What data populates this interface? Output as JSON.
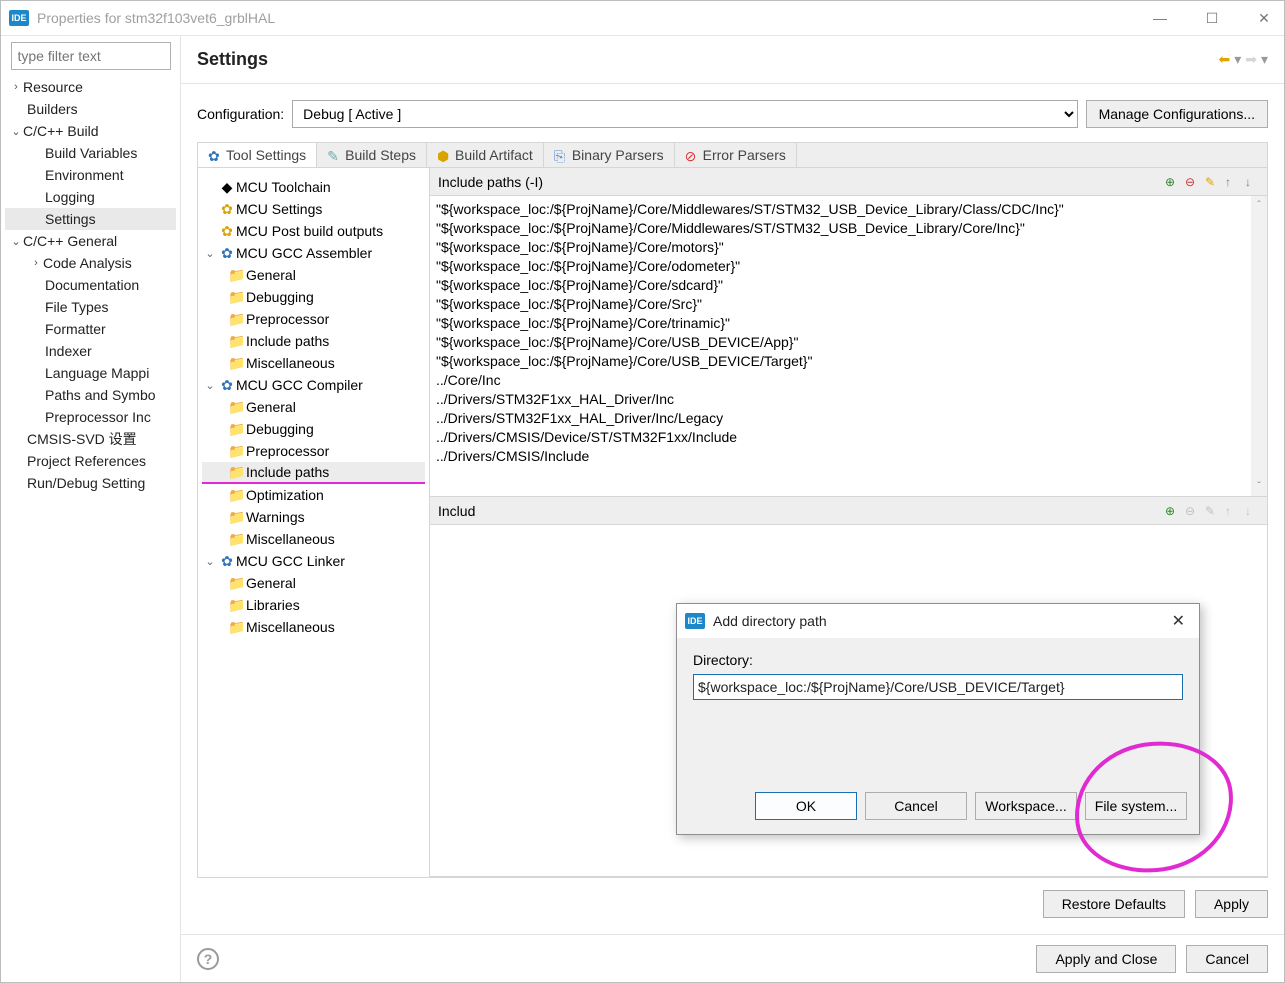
{
  "window": {
    "title": "Properties for stm32f103vet6_grblHAL",
    "ide_badge": "IDE"
  },
  "filter_placeholder": "type filter text",
  "nav": {
    "resource": "Resource",
    "builders": "Builders",
    "build": "C/C++ Build",
    "build_children": {
      "build_vars": "Build Variables",
      "env": "Environment",
      "logging": "Logging",
      "settings": "Settings"
    },
    "general": "C/C++ General",
    "general_children": {
      "code_analysis": "Code Analysis",
      "documentation": "Documentation",
      "file_types": "File Types",
      "formatter": "Formatter",
      "indexer": "Indexer",
      "lang_map": "Language Mappi",
      "paths_sym": "Paths and Symbo",
      "pre_inc": "Preprocessor Inc"
    },
    "cmsis": "CMSIS-SVD 设置",
    "proj_refs": "Project References",
    "run_debug": "Run/Debug Setting"
  },
  "header": {
    "title": "Settings"
  },
  "config": {
    "label": "Configuration:",
    "value": "Debug  [ Active ]",
    "manage": "Manage Configurations..."
  },
  "tabs": {
    "tool": "Tool Settings",
    "steps": "Build Steps",
    "artifact": "Build Artifact",
    "binary": "Binary Parsers",
    "error": "Error Parsers"
  },
  "tooltree": {
    "toolchain": "MCU Toolchain",
    "settings": "MCU Settings",
    "post": "MCU Post build outputs",
    "asm": "MCU GCC Assembler",
    "compiler": "MCU GCC Compiler",
    "linker": "MCU GCC Linker",
    "leaf": {
      "general": "General",
      "debugging": "Debugging",
      "preprocessor": "Preprocessor",
      "include": "Include paths",
      "misc": "Miscellaneous",
      "optimization": "Optimization",
      "warnings": "Warnings",
      "libraries": "Libraries"
    }
  },
  "section1": {
    "title": "Include paths (-I)"
  },
  "section2": {
    "title": "Includ"
  },
  "include_paths": [
    "\"${workspace_loc:/${ProjName}/Core/Middlewares/ST/STM32_USB_Device_Library/Class/CDC/Inc}\"",
    "\"${workspace_loc:/${ProjName}/Core/Middlewares/ST/STM32_USB_Device_Library/Core/Inc}\"",
    "\"${workspace_loc:/${ProjName}/Core/motors}\"",
    "\"${workspace_loc:/${ProjName}/Core/odometer}\"",
    "\"${workspace_loc:/${ProjName}/Core/sdcard}\"",
    "\"${workspace_loc:/${ProjName}/Core/Src}\"",
    "\"${workspace_loc:/${ProjName}/Core/trinamic}\"",
    "\"${workspace_loc:/${ProjName}/Core/USB_DEVICE/App}\"",
    "\"${workspace_loc:/${ProjName}/Core/USB_DEVICE/Target}\"",
    "../Core/Inc",
    "../Drivers/STM32F1xx_HAL_Driver/Inc",
    "../Drivers/STM32F1xx_HAL_Driver/Inc/Legacy",
    "../Drivers/CMSIS/Device/ST/STM32F1xx/Include",
    "../Drivers/CMSIS/Include"
  ],
  "footer": {
    "restore": "Restore Defaults",
    "apply": "Apply"
  },
  "bottom": {
    "apply_close": "Apply and Close",
    "cancel": "Cancel"
  },
  "dialog": {
    "title": "Add directory path",
    "dir_label": "Directory:",
    "dir_value": "${workspace_loc:/${ProjName}/Core/USB_DEVICE/Target}",
    "ok": "OK",
    "cancel": "Cancel",
    "workspace": "Workspace...",
    "filesystem": "File system..."
  }
}
